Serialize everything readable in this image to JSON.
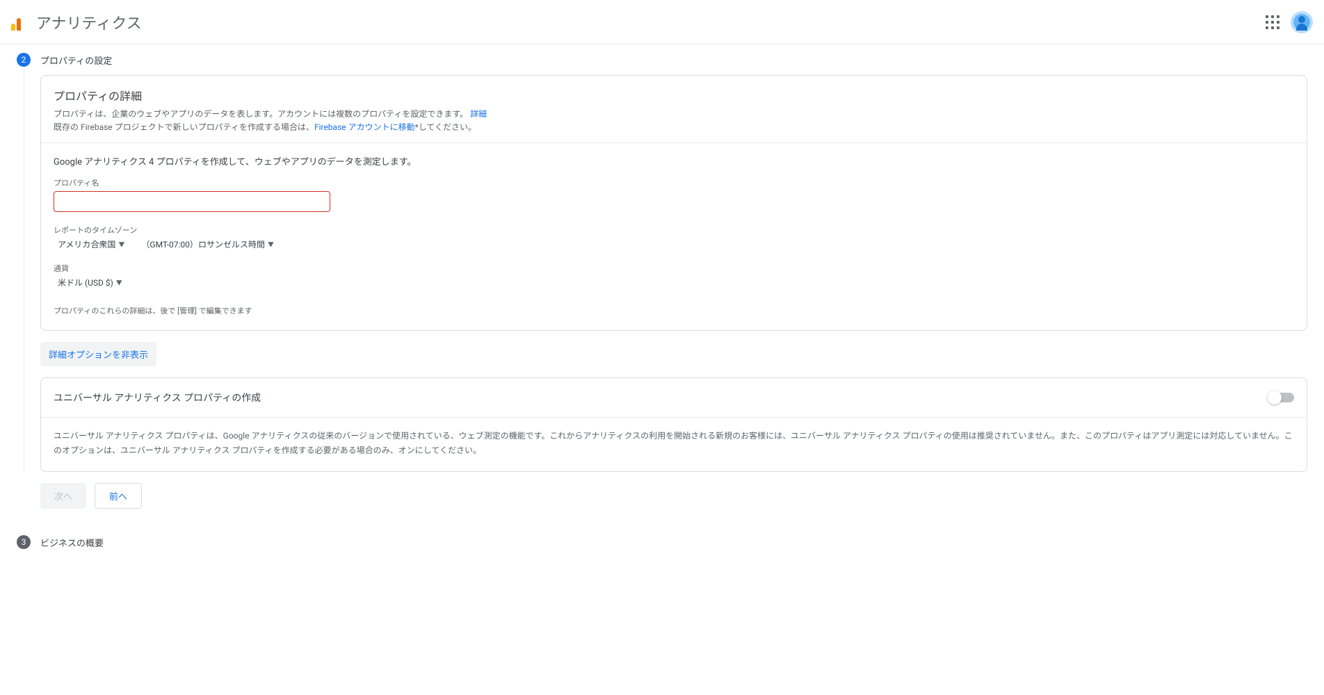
{
  "header": {
    "app_title": "アナリティクス"
  },
  "step2": {
    "num": "2",
    "title": "プロパティの設定",
    "card": {
      "title": "プロパティの詳細",
      "sub1": "プロパティは、企業のウェブやアプリのデータを表します。アカウントには複数のプロパティを設定できます。",
      "sub1_link": "詳細",
      "sub2_prefix": "既存の Firebase プロジェクトで新しいプロパティを作成する場合は、",
      "sub2_link": "Firebase アカウントに移動",
      "sub2_suffix": "*してください。",
      "body_desc": "Google アナリティクス 4 プロパティを作成して、ウェブやアプリのデータを測定します。",
      "name_label": "プロパティ名",
      "name_value": "",
      "tz_label": "レポートのタイムゾーン",
      "tz_country": "アメリカ合衆国",
      "tz_time": "（GMT-07:00）ロサンゼルス時間",
      "currency_label": "通貨",
      "currency_value": "米ドル (USD $)",
      "edit_note": "プロパティのこれらの詳細は、後で [管理] で編集できます"
    },
    "hide_opts": "詳細オプションを非表示",
    "ua": {
      "title": "ユニバーサル アナリティクス プロパティの作成",
      "text": "ユニバーサル アナリティクス プロパティは、Google アナリティクスの従来のバージョンで使用されている、ウェブ測定の機能です。これからアナリティクスの利用を開始される新規のお客様には、ユニバーサル アナリティクス プロパティの使用は推奨されていません。また、このプロパティはアプリ測定には対応していません。このオプションは、ユニバーサル アナリティクス プロパティを作成する必要がある場合のみ、オンにしてください。"
    },
    "next": "次へ",
    "prev": "前へ"
  },
  "step3": {
    "num": "3",
    "title": "ビジネスの概要"
  }
}
